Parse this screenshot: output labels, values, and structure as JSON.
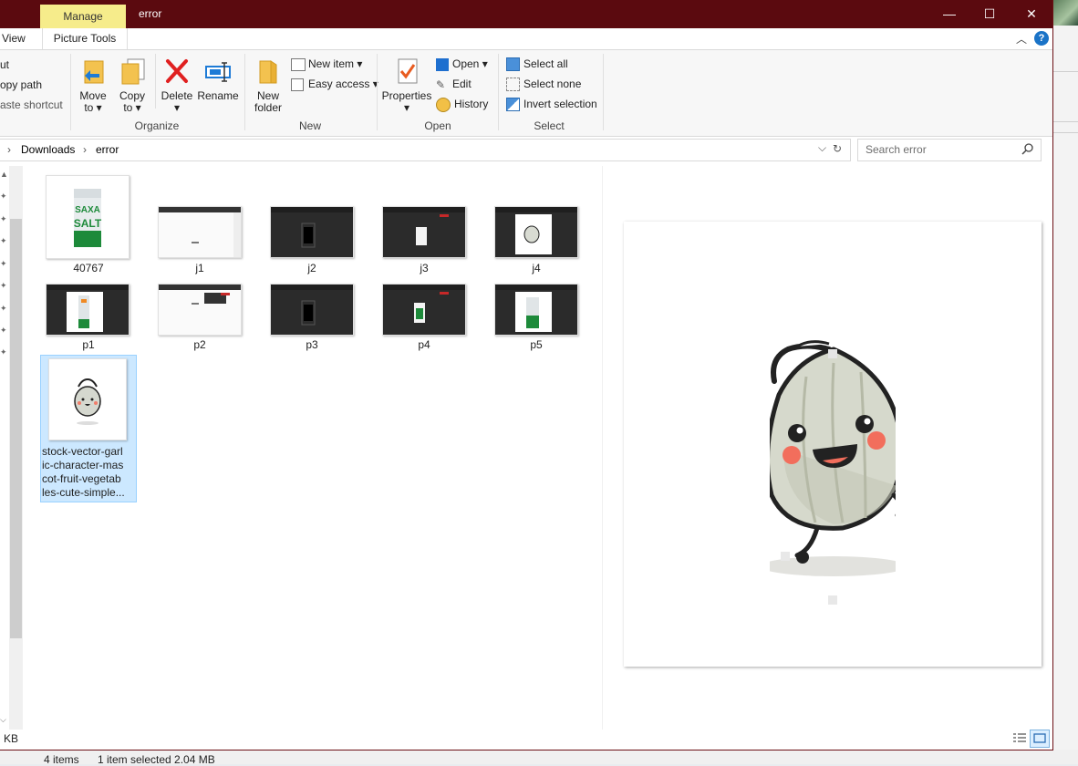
{
  "window": {
    "title": "error",
    "context_tab": "Manage",
    "minimize": "—",
    "maximize": "☐",
    "close": "✕"
  },
  "tabs": {
    "view": "View",
    "picture_tools": "Picture Tools"
  },
  "ribbon": {
    "clipboard": {
      "cut": "ut",
      "copy_path": "opy path",
      "paste_shortcut": "aste shortcut"
    },
    "organize": {
      "label": "Organize",
      "move_to": "Move",
      "move_to2": "to ▾",
      "copy_to": "Copy",
      "copy_to2": "to ▾",
      "delete": "Delete",
      "delete2": "▾",
      "rename": "Rename"
    },
    "new": {
      "label": "New",
      "new_folder": "New",
      "new_folder2": "folder",
      "new_item": "New item ▾",
      "easy_access": "Easy access ▾"
    },
    "open": {
      "label": "Open",
      "properties": "Properties",
      "properties2": "▾",
      "open": "Open ▾",
      "edit": "Edit",
      "history": "History"
    },
    "select": {
      "label": "Select",
      "select_all": "Select all",
      "select_none": "Select none",
      "invert_selection": "Invert selection"
    }
  },
  "address": {
    "sep1": "›",
    "crumb1": "Downloads",
    "sep2": "›",
    "crumb2": "error",
    "dropdown": "⌵",
    "refresh": "↻"
  },
  "search": {
    "placeholder": "Search error"
  },
  "files": [
    {
      "name": "40767",
      "kind": "salt"
    },
    {
      "name": "j1",
      "kind": "white"
    },
    {
      "name": "j2",
      "kind": "dark"
    },
    {
      "name": "j3",
      "kind": "dark-small"
    },
    {
      "name": "j4",
      "kind": "dark-garlic"
    },
    {
      "name": "p1",
      "kind": "dark-salt"
    },
    {
      "name": "p2",
      "kind": "white-red"
    },
    {
      "name": "p3",
      "kind": "dark"
    },
    {
      "name": "p4",
      "kind": "dark-green"
    },
    {
      "name": "p5",
      "kind": "dark-salt"
    },
    {
      "name": "stock-vector-garl",
      "name2": "ic-character-mas",
      "name3": "cot-fruit-vegetab",
      "name4": "les-cute-simple...",
      "kind": "garlic"
    }
  ],
  "status": {
    "size": "KB",
    "items": "4 items",
    "selected": "1 item selected  2.04 MB"
  },
  "colors": {
    "titlebar": "#5b0a0f",
    "manage": "#f6ec8b",
    "selection": "#cce8ff",
    "accent": "#1a73c7"
  }
}
